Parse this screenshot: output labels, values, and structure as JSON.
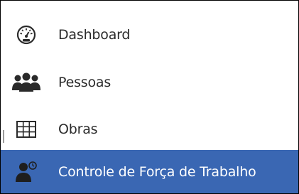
{
  "menu": {
    "items": [
      {
        "label": "Dashboard",
        "icon": "dashboard-gauge-icon",
        "active": false
      },
      {
        "label": "Pessoas",
        "icon": "people-group-icon",
        "active": false
      },
      {
        "label": "Obras",
        "icon": "grid-table-icon",
        "active": false
      },
      {
        "label": "Controle de Força de Trabalho",
        "icon": "user-clock-icon",
        "active": true
      }
    ]
  },
  "colors": {
    "active_background": "#3a67b3",
    "active_text": "#ffffff",
    "text": "#2b2b2b",
    "icon": "#2a2a2a",
    "border": "#000000"
  }
}
